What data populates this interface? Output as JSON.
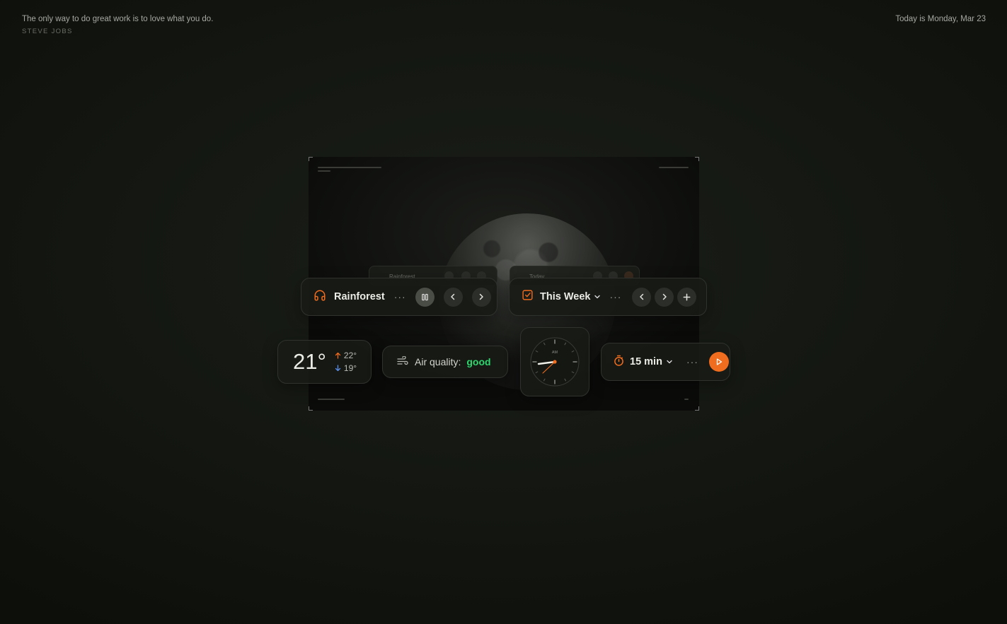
{
  "quote": {
    "text": "The only way to do great work is to love what you do.",
    "author": "STEVE JOBS"
  },
  "date": "Today is Monday, Mar 23",
  "preview": {
    "music_label": "Rainforest",
    "tasks_label": "Today"
  },
  "music": {
    "title": "Rainforest",
    "more": "···",
    "icon": "headphones-icon",
    "state": "playing"
  },
  "tasks": {
    "title": "This Week",
    "more": "···",
    "icon": "checkbox-icon"
  },
  "weather": {
    "temp": "21°",
    "high": "22°",
    "low": "19°"
  },
  "air": {
    "label": "Air quality:",
    "value": "good",
    "value_color": "#2fd66e"
  },
  "clock": {
    "period": "AM"
  },
  "timer": {
    "duration": "15 min",
    "more": "···",
    "accent": "#f06c1e"
  },
  "colors": {
    "accent": "#f06c1e",
    "good": "#2fd66e",
    "background": "#141712"
  }
}
